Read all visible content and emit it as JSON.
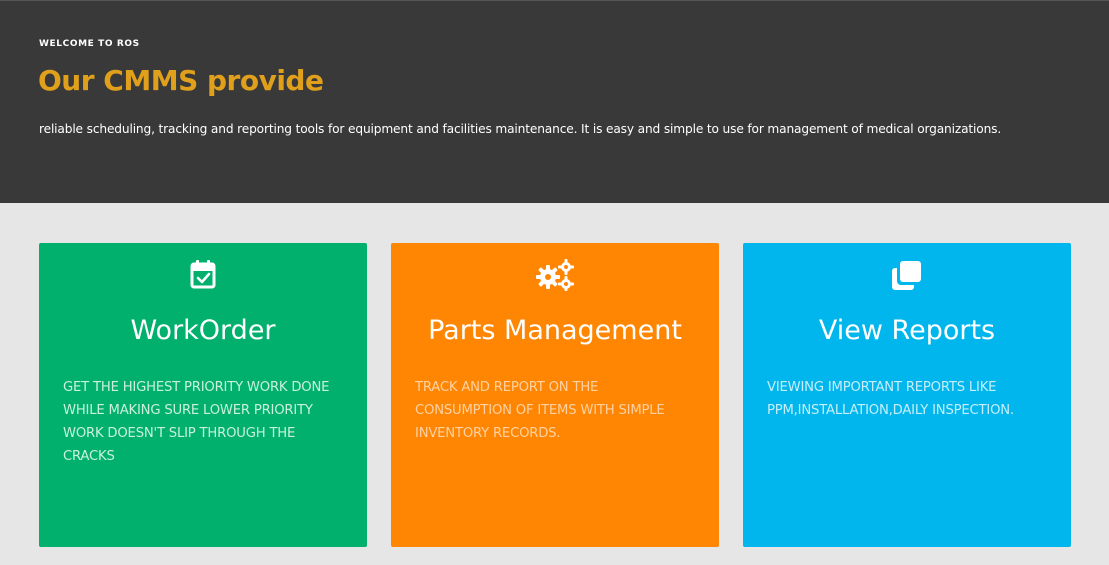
{
  "hero": {
    "eyebrow": "WELCOME TO ROS",
    "title": "Our CMMS provide",
    "description": "reliable scheduling, tracking and reporting tools for equipment and facilities maintenance. It is easy and simple to use for management of medical organizations."
  },
  "cards": [
    {
      "icon": "calendar-check-icon",
      "title": "WorkOrder",
      "description": "GET THE HIGHEST PRIORITY WORK DONE WHILE MAKING SURE LOWER PRIORITY WORK DOESN'T SLIP THROUGH THE CRACKS",
      "color": "#00b06c"
    },
    {
      "icon": "gears-icon",
      "title": "Parts Management",
      "description": "TRACK AND REPORT ON THE CONSUMPTION OF ITEMS WITH SIMPLE INVENTORY RECORDS.",
      "color": "#ff8602"
    },
    {
      "icon": "clone-icon",
      "title": "View Reports",
      "description": "VIEWING IMPORTANT REPORTS LIKE PPM,INSTALLATION,DAILY INSPECTION.",
      "color": "#00b6ec"
    }
  ],
  "colors": {
    "hero_bg": "#393939",
    "title_accent": "#e1a01b",
    "page_bg": "#e6e6e6"
  }
}
